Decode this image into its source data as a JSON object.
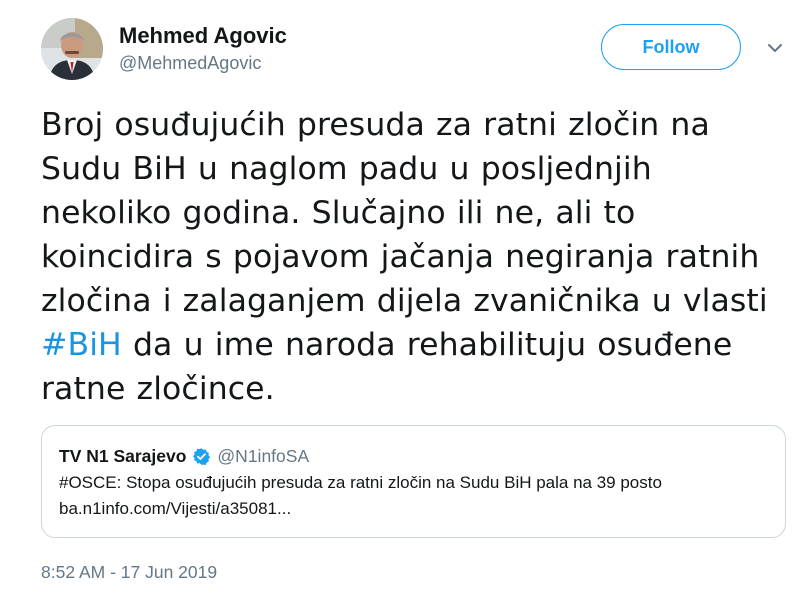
{
  "author": {
    "display_name": "Mehmed Agovic",
    "handle": "@MehmedAgovic"
  },
  "actions": {
    "follow_label": "Follow",
    "more_icon": "chevron-down-icon"
  },
  "tweet": {
    "lines": [
      "Broj osuđujućih presuda za ratni zločin na",
      "Sudu BiH u naglom padu u posljednjih",
      "nekoliko godina. Slučajno ili ne, ali to",
      "koincidira s pojavom jačanja negiranja ratnih",
      "zločina i zalaganjem dijela zvaničnika u vlasti"
    ],
    "hashtag": "#BiH",
    "hashtag_line_rest": " da u ime naroda rehabilituju osuđene",
    "last_line": "ratne zločince."
  },
  "quoted": {
    "name": "TV N1 Sarajevo",
    "handle": "@N1infoSA",
    "text": "#OSCE: Stopa osuđujućih presuda za ratni zločin na Sudu BiH pala na 39 posto",
    "link": "ba.n1info.com/Vijesti/a35081..."
  },
  "timestamp": "8:52 AM - 17 Jun 2019",
  "colors": {
    "accent": "#1da1f2",
    "hashtag": "#1b95e0",
    "muted": "#657786",
    "border": "#ccd6dd"
  }
}
